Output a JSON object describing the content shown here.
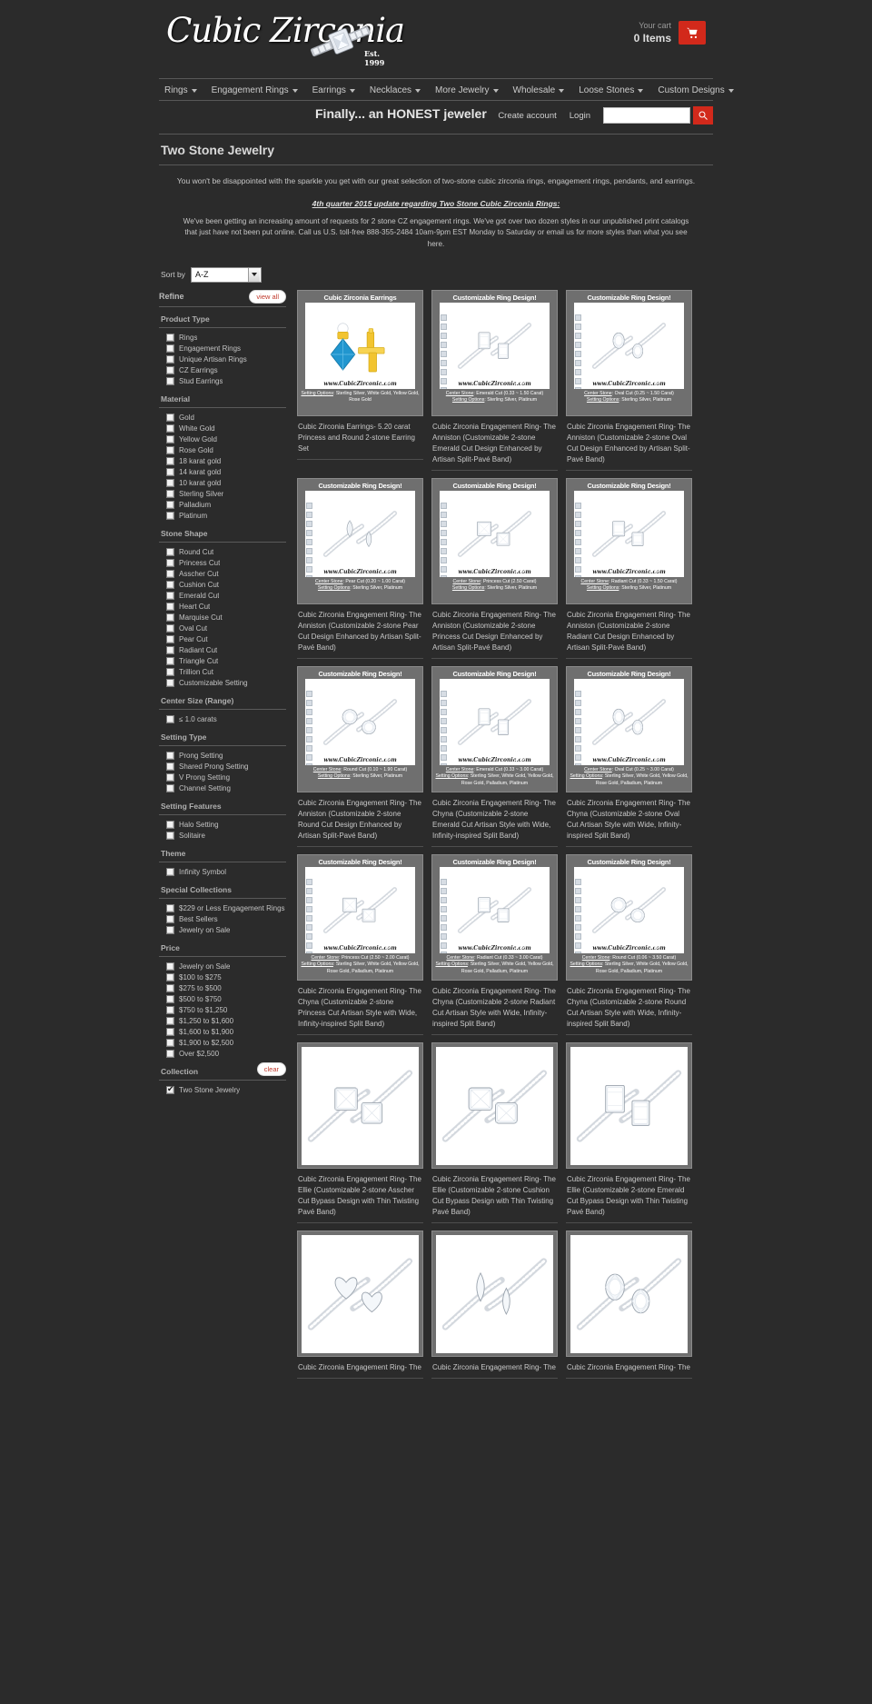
{
  "brand": {
    "name": "Cubic Zirconia",
    "established": "Est. 1999"
  },
  "cart": {
    "label": "Your cart",
    "count": "0 Items",
    "icon": "shopping-cart-icon"
  },
  "nav": [
    {
      "label": "Rings"
    },
    {
      "label": "Engagement Rings"
    },
    {
      "label": "Earrings"
    },
    {
      "label": "Necklaces"
    },
    {
      "label": "More Jewelry"
    },
    {
      "label": "Wholesale"
    },
    {
      "label": "Loose Stones"
    },
    {
      "label": "Custom Designs"
    }
  ],
  "util": {
    "tagline": "Finally... an HONEST jeweler",
    "create_account": "Create account",
    "login": "Login",
    "search_value": "",
    "search_placeholder": ""
  },
  "page": {
    "title": "Two Stone Jewelry",
    "intro": "You won't be disappointed with the sparkle you get with our great selection of two-stone cubic zirconia rings, engagement rings, pendants, and earrings.",
    "update_heading": "4th quarter 2015 update regarding Two Stone Cubic Zirconia Rings:",
    "update_body": "We've been getting an increasing amount of requests for 2 stone CZ engagement rings. We've got over two dozen styles in our unpublished print catalogs that just have not been put online. Call us U.S. toll-free 888-355-2484 10am-9pm EST Monday to Saturday or email us for more styles than what you see here."
  },
  "sort": {
    "label": "Sort by",
    "value": "A-Z",
    "options": [
      "A-Z"
    ]
  },
  "refine": {
    "title": "Refine",
    "view_all": "view all",
    "clear": "clear",
    "groups": [
      {
        "title": "Product Type",
        "options": [
          {
            "label": "Rings",
            "checked": false
          },
          {
            "label": "Engagement Rings",
            "checked": false
          },
          {
            "label": "Unique Artisan Rings",
            "checked": false
          },
          {
            "label": "CZ Earrings",
            "checked": false
          },
          {
            "label": "Stud Earrings",
            "checked": false
          }
        ]
      },
      {
        "title": "Material",
        "options": [
          {
            "label": "Gold",
            "checked": false
          },
          {
            "label": "White Gold",
            "checked": false
          },
          {
            "label": "Yellow Gold",
            "checked": false
          },
          {
            "label": "Rose Gold",
            "checked": false
          },
          {
            "label": "18 karat gold",
            "checked": false
          },
          {
            "label": "14 karat gold",
            "checked": false
          },
          {
            "label": "10 karat gold",
            "checked": false
          },
          {
            "label": "Sterling Silver",
            "checked": false
          },
          {
            "label": "Palladium",
            "checked": false
          },
          {
            "label": "Platinum",
            "checked": false
          }
        ]
      },
      {
        "title": "Stone Shape",
        "options": [
          {
            "label": "Round Cut",
            "checked": false
          },
          {
            "label": "Princess Cut",
            "checked": false
          },
          {
            "label": "Asscher Cut",
            "checked": false
          },
          {
            "label": "Cushion Cut",
            "checked": false
          },
          {
            "label": "Emerald Cut",
            "checked": false
          },
          {
            "label": "Heart Cut",
            "checked": false
          },
          {
            "label": "Marquise Cut",
            "checked": false
          },
          {
            "label": "Oval Cut",
            "checked": false
          },
          {
            "label": "Pear Cut",
            "checked": false
          },
          {
            "label": "Radiant Cut",
            "checked": false
          },
          {
            "label": "Triangle Cut",
            "checked": false
          },
          {
            "label": "Trillion Cut",
            "checked": false
          },
          {
            "label": "Customizable Setting",
            "checked": false
          }
        ]
      },
      {
        "title": "Center Size (Range)",
        "options": [
          {
            "label": "≤ 1.0 carats",
            "checked": false
          }
        ]
      },
      {
        "title": "Setting Type",
        "options": [
          {
            "label": "Prong Setting",
            "checked": false
          },
          {
            "label": "Shared Prong Setting",
            "checked": false
          },
          {
            "label": "V Prong Setting",
            "checked": false
          },
          {
            "label": "Channel Setting",
            "checked": false
          }
        ]
      },
      {
        "title": "Setting Features",
        "options": [
          {
            "label": "Halo Setting",
            "checked": false
          },
          {
            "label": "Solitaire",
            "checked": false
          }
        ]
      },
      {
        "title": "Theme",
        "options": [
          {
            "label": "Infinity Symbol",
            "checked": false
          }
        ]
      },
      {
        "title": "Special Collections",
        "options": [
          {
            "label": "$229 or Less Engagement Rings",
            "checked": false
          },
          {
            "label": "Best Sellers",
            "checked": false
          },
          {
            "label": "Jewelry on Sale",
            "checked": false
          }
        ]
      },
      {
        "title": "Price",
        "options": [
          {
            "label": "Jewelry on Sale",
            "checked": false
          },
          {
            "label": "$100 to $275",
            "checked": false
          },
          {
            "label": "$275 to $500",
            "checked": false
          },
          {
            "label": "$500 to $750",
            "checked": false
          },
          {
            "label": "$750 to $1,250",
            "checked": false
          },
          {
            "label": "$1,250 to $1,600",
            "checked": false
          },
          {
            "label": "$1,600 to $1,900",
            "checked": false
          },
          {
            "label": "$1,900 to $2,500",
            "checked": false
          },
          {
            "label": "Over $2,500",
            "checked": false
          }
        ]
      },
      {
        "title": "Collection",
        "has_clear": true,
        "options": [
          {
            "label": "Two Stone Jewelry",
            "checked": true
          }
        ]
      }
    ]
  },
  "products": [
    {
      "banner": "Cubic Zirconia Earrings",
      "kind": "earrings",
      "url": "www.CubicZirconia.com",
      "center_stone": "",
      "setting_options": "Setting Options: Sterling Silver, White Gold, Yellow Gold, Rose Gold",
      "title": "Cubic Zirconia Earrings- 5.20 carat Princess and Round 2-stone Earring Set"
    },
    {
      "banner": "Customizable Ring Design!",
      "kind": "emerald-bypass",
      "url": "www.CubicZirconia.com",
      "center_stone": "Center Stone: Emerald Cut (0.33 ~ 1.50 Carat)",
      "setting_options": "Setting Options: Sterling Silver, Platinum",
      "title": "Cubic Zirconia Engagement Ring- The Anniston (Customizable 2-stone Emerald Cut Design Enhanced by Artisan Split-Pavé Band)"
    },
    {
      "banner": "Customizable Ring Design!",
      "kind": "oval-bypass",
      "url": "www.CubicZirconia.com",
      "center_stone": "Center Stone: Oval Cut (0.25 ~ 1.50 Carat)",
      "setting_options": "Setting Options: Sterling Silver, Platinum",
      "title": "Cubic Zirconia Engagement Ring- The Anniston (Customizable 2-stone Oval Cut Design Enhanced by Artisan Split-Pavé Band)"
    },
    {
      "banner": "Customizable Ring Design!",
      "kind": "pear-bypass",
      "url": "www.CubicZirconia.com",
      "center_stone": "Center Stone: Pear Cut (0.20 ~ 1.00 Carat)",
      "setting_options": "Setting Options: Sterling Silver, Platinum",
      "title": "Cubic Zirconia Engagement Ring- The Anniston (Customizable 2-stone Pear Cut Design Enhanced by Artisan Split-Pavé Band)"
    },
    {
      "banner": "Customizable Ring Design!",
      "kind": "princess-bypass",
      "url": "www.CubicZirconia.com",
      "center_stone": "Center Stone: Princess Cut (2.50 Carat)",
      "setting_options": "Setting Options: Sterling Silver, Platinum",
      "title": "Cubic Zirconia Engagement Ring- The Anniston (Customizable 2-stone Princess Cut Design Enhanced by Artisan Split-Pavé Band)"
    },
    {
      "banner": "Customizable Ring Design!",
      "kind": "radiant-bypass",
      "url": "www.CubicZirconia.com",
      "center_stone": "Center Stone: Radiant Cut (0.33 ~ 1.50 Carat)",
      "setting_options": "Setting Options: Sterling Silver, Platinum",
      "title": "Cubic Zirconia Engagement Ring- The Anniston (Customizable 2-stone Radiant Cut Design Enhanced by Artisan Split-Pavé Band)"
    },
    {
      "banner": "Customizable Ring Design!",
      "kind": "round-pave",
      "url": "www.CubicZirconia.com",
      "center_stone": "Center Stone: Round Cut (0.10 ~ 1.90 Carat)",
      "setting_options": "Setting Options: Sterling Silver, Platinum",
      "title": "Cubic Zirconia Engagement Ring- The Anniston (Customizable 2-stone Round Cut Design Enhanced by Artisan Split-Pavé Band)"
    },
    {
      "banner": "Customizable Ring Design!",
      "kind": "emerald-infinity",
      "url": "www.CubicZirconia.com",
      "center_stone": "Center Stone: Emerald Cut (0.33 ~ 3.00 Carat)",
      "setting_options": "Setting Options: Sterling Silver, White Gold, Yellow Gold, Rose Gold, Palladium, Platinum",
      "title": "Cubic Zirconia Engagement Ring- The Chyna (Customizable 2-stone Emerald Cut Artisan Style with Wide, Infinity-inspired Split Band)"
    },
    {
      "banner": "Customizable Ring Design!",
      "kind": "oval-infinity",
      "url": "www.CubicZirconia.com",
      "center_stone": "Center Stone: Oval Cut (0.25 ~ 3.00 Carat)",
      "setting_options": "Setting Options: Sterling Silver, White Gold, Yellow Gold, Rose Gold, Palladium, Platinum",
      "title": "Cubic Zirconia Engagement Ring- The Chyna (Customizable 2-stone Oval Cut Artisan Style with Wide, Infinity-inspired Split Band)"
    },
    {
      "banner": "Customizable Ring Design!",
      "kind": "princess-infinity",
      "url": "www.CubicZirconia.com",
      "center_stone": "Center Stone: Princess Cut (2.50 ~ 2.00 Carat)",
      "setting_options": "Setting Options: Sterling Silver, White Gold, Yellow Gold, Rose Gold, Palladium, Platinum",
      "title": "Cubic Zirconia Engagement Ring- The Chyna (Customizable 2-stone Princess Cut Artisan Style with Wide, Infinity-inspired Split Band)"
    },
    {
      "banner": "Customizable Ring Design!",
      "kind": "radiant-infinity",
      "url": "www.CubicZirconia.com",
      "center_stone": "Center Stone: Radiant Cut (0.33 ~ 3.00 Carat)",
      "setting_options": "Setting Options: Sterling Silver, White Gold, Yellow Gold, Rose Gold, Palladium, Platinum",
      "title": "Cubic Zirconia Engagement Ring- The Chyna (Customizable 2-stone Radiant Cut Artisan Style with Wide, Infinity-inspired Split Band)"
    },
    {
      "banner": "Customizable Ring Design!",
      "kind": "round-infinity",
      "url": "www.CubicZirconia.com",
      "center_stone": "Center Stone: Round Cut (0.06 ~ 3.50 Carat)",
      "setting_options": "Setting Options: Sterling Silver, White Gold, Yellow Gold, Rose Gold, Palladium, Platinum",
      "title": "Cubic Zirconia Engagement Ring- The Chyna (Customizable 2-stone Round Cut Artisan Style with Wide, Infinity-inspired Split Band)"
    },
    {
      "banner": "",
      "kind": "asscher-twist",
      "url": "",
      "center_stone": "",
      "setting_options": "",
      "title": "Cubic Zirconia Engagement Ring- The Ellie (Customizable 2-stone Asscher Cut Bypass Design with Thin Twisting Pavé Band)"
    },
    {
      "banner": "",
      "kind": "cushion-twist",
      "url": "",
      "center_stone": "",
      "setting_options": "",
      "title": "Cubic Zirconia Engagement Ring- The Ellie (Customizable 2-stone Cushion Cut Bypass Design with Thin Twisting Pavé Band)"
    },
    {
      "banner": "",
      "kind": "emerald-twist",
      "url": "",
      "center_stone": "",
      "setting_options": "",
      "title": "Cubic Zirconia Engagement Ring- The Ellie (Customizable 2-stone Emerald Cut Bypass Design with Thin Twisting Pavé Band)"
    },
    {
      "banner": "",
      "kind": "heart-twist",
      "url": "",
      "center_stone": "",
      "setting_options": "",
      "title": "Cubic Zirconia Engagement Ring- The"
    },
    {
      "banner": "",
      "kind": "marquise-twist",
      "url": "",
      "center_stone": "",
      "setting_options": "",
      "title": "Cubic Zirconia Engagement Ring- The"
    },
    {
      "banner": "",
      "kind": "oval-twist",
      "url": "",
      "center_stone": "",
      "setting_options": "",
      "title": "Cubic Zirconia Engagement Ring- The"
    }
  ],
  "colors": {
    "accent": "#d2291b",
    "background": "#2b2b2b",
    "card": "#6f6f6f",
    "text": "#c9c9c9"
  }
}
